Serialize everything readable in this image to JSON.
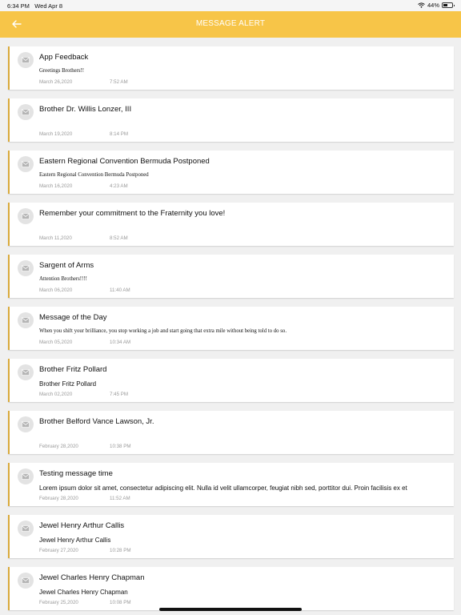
{
  "status_bar": {
    "time": "6:34 PM",
    "date": "Wed Apr 8",
    "battery": "44%"
  },
  "header": {
    "title": "MESSAGE ALERT",
    "back_icon": "arrow-left-icon"
  },
  "messages": [
    {
      "subject": "App Feedback",
      "body": "Greetings Brothers!!",
      "body_style": "serif",
      "date": "March 26,2020",
      "time": "7:52 AM"
    },
    {
      "subject": "Brother Dr. Willis Lonzer, III",
      "body": "",
      "body_style": "sans",
      "date": "March 19,2020",
      "time": "8:14 PM"
    },
    {
      "subject": "Eastern Regional Convention Bermuda Postponed",
      "body": "Eastern Regional Convention Bermuda Postponed",
      "body_style": "serif",
      "date": "March 16,2020",
      "time": "4:23 AM"
    },
    {
      "subject": "Remember your commitment to the Fraternity you love!",
      "body": "",
      "body_style": "sans",
      "date": "March 11,2020",
      "time": "8:52 AM"
    },
    {
      "subject": "Sargent of Arms",
      "body": "Attention Brothers!!!!",
      "body_style": "serif",
      "date": "March 06,2020",
      "time": "11:40 AM"
    },
    {
      "subject": "Message of the Day",
      "body": "When you shift your brilliance, you stop working a job and start going that extra mile without being told to do so.",
      "body_style": "serif",
      "date": "March 05,2020",
      "time": "10:34 AM"
    },
    {
      "subject": "Brother Fritz Pollard",
      "body": "Brother Fritz Pollard",
      "body_style": "sans",
      "date": "March 02,2020",
      "time": "7:45 PM"
    },
    {
      "subject": "Brother Belford Vance Lawson, Jr.",
      "body": "",
      "body_style": "sans",
      "date": "February 28,2020",
      "time": "10:38 PM"
    },
    {
      "subject": "Testing message time",
      "body": "Lorem ipsum dolor sit amet, consectetur adipiscing elit. Nulla id velit ullamcorper, feugiat nibh sed, porttitor dui. Proin facilisis ex et",
      "body_style": "sans",
      "date": "February 28,2020",
      "time": "11:52 AM"
    },
    {
      "subject": "Jewel Henry Arthur Callis",
      "body": "Jewel Henry Arthur Callis",
      "body_style": "sans",
      "date": "February 27,2020",
      "time": "10:28 PM"
    },
    {
      "subject": "Jewel Charles Henry Chapman",
      "body": "Jewel Charles Henry Chapman",
      "body_style": "sans",
      "date": "February 25,2020",
      "time": "10:08 PM"
    }
  ],
  "colors": {
    "header": "#f7c548",
    "accent_border": "#d9a93a",
    "background": "#f0f0f0",
    "meta_text": "#9a9a9a"
  }
}
